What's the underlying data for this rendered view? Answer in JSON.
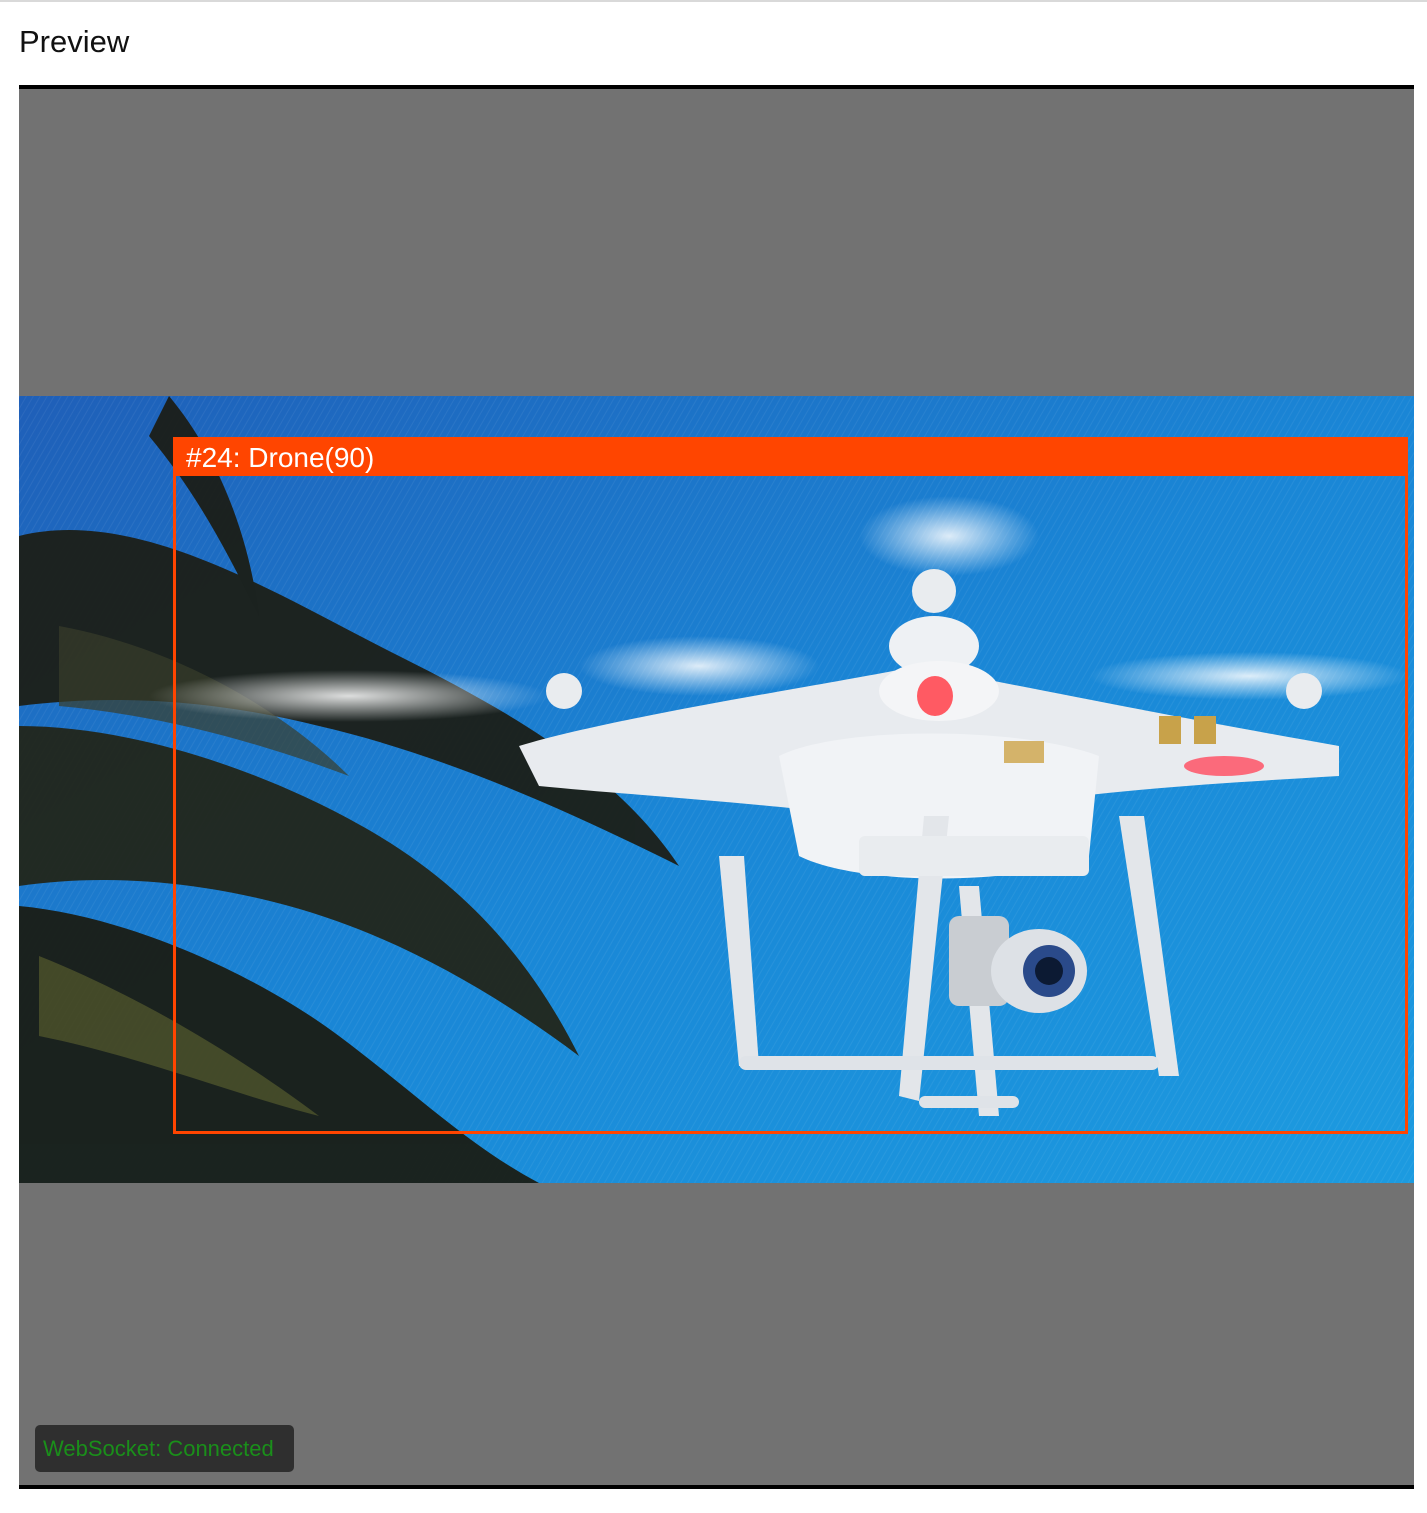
{
  "page": {
    "title": "Preview"
  },
  "viewer": {
    "background_color": "#727272",
    "frame_description_icon": "drone-camera-frame",
    "detections": [
      {
        "id_label": "#24: Drone(90)",
        "color": "#ff4500"
      }
    ],
    "status": {
      "text": "WebSocket: Connected",
      "color": "#1a8f1a"
    }
  }
}
